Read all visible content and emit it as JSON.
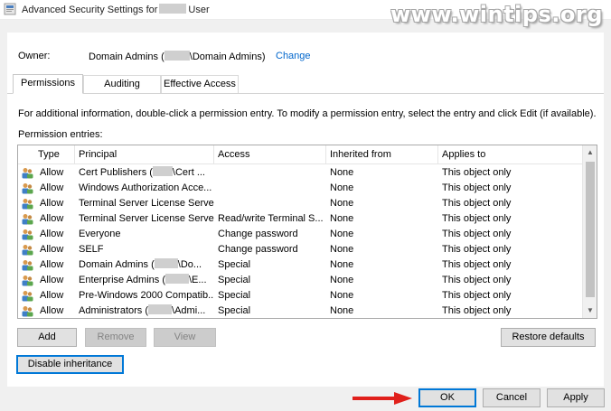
{
  "window": {
    "title_prefix": "Advanced Security Settings for",
    "title_suffix": "User",
    "watermark": "www.wintips.org"
  },
  "owner": {
    "label": "Owner:",
    "value_prefix": "Domain Admins (",
    "value_suffix": "\\Domain Admins)",
    "change_link": "Change"
  },
  "tabs": [
    {
      "label": "Permissions",
      "active": true
    },
    {
      "label": "Auditing",
      "active": false
    },
    {
      "label": "Effective Access",
      "active": false
    }
  ],
  "info_text": "For additional information, double-click a permission entry. To modify a permission entry, select the entry and click Edit (if available).",
  "permission_entries_label": "Permission entries:",
  "columns": [
    "Type",
    "Principal",
    "Access",
    "Inherited from",
    "Applies to"
  ],
  "entries": [
    {
      "type": "Allow",
      "principal_a": "Cert Publishers (",
      "principal_b": "\\Cert ...",
      "access": "",
      "inherited": "None",
      "applies": "This object only"
    },
    {
      "type": "Allow",
      "principal_a": "Windows Authorization Acce...",
      "principal_b": "",
      "access": "",
      "inherited": "None",
      "applies": "This object only"
    },
    {
      "type": "Allow",
      "principal_a": "Terminal Server License Serve...",
      "principal_b": "",
      "access": "",
      "inherited": "None",
      "applies": "This object only"
    },
    {
      "type": "Allow",
      "principal_a": "Terminal Server License Serve...",
      "principal_b": "",
      "access": "Read/write Terminal S...",
      "inherited": "None",
      "applies": "This object only"
    },
    {
      "type": "Allow",
      "principal_a": "Everyone",
      "principal_b": "",
      "access": "Change password",
      "inherited": "None",
      "applies": "This object only"
    },
    {
      "type": "Allow",
      "principal_a": "SELF",
      "principal_b": "",
      "access": "Change password",
      "inherited": "None",
      "applies": "This object only"
    },
    {
      "type": "Allow",
      "principal_a": "Domain Admins (",
      "principal_b": "\\Do...",
      "access": "Special",
      "inherited": "None",
      "applies": "This object only"
    },
    {
      "type": "Allow",
      "principal_a": "Enterprise Admins (",
      "principal_b": "\\E...",
      "access": "Special",
      "inherited": "None",
      "applies": "This object only"
    },
    {
      "type": "Allow",
      "principal_a": "Pre-Windows 2000 Compatib...",
      "principal_b": "",
      "access": "Special",
      "inherited": "None",
      "applies": "This object only"
    },
    {
      "type": "Allow",
      "principal_a": "Administrators (",
      "principal_b": "\\Admi...",
      "access": "Special",
      "inherited": "None",
      "applies": "This object only"
    }
  ],
  "buttons": {
    "add": "Add",
    "remove": "Remove",
    "view": "View",
    "restore": "Restore defaults",
    "disable_inheritance": "Disable inheritance",
    "ok": "OK",
    "cancel": "Cancel",
    "apply": "Apply"
  },
  "colors": {
    "link": "#0066cc",
    "accent": "#0078d7",
    "arrow": "#e0201b"
  },
  "icons": {
    "window": "security-shield-icon",
    "principal": "user-group-icon"
  }
}
